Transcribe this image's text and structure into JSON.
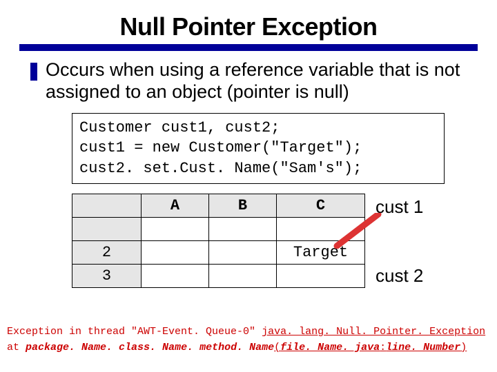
{
  "title": "Null Pointer Exception",
  "bullet": "Occurs when using a reference variable that is not assigned to an object (pointer is null)",
  "code": {
    "line1": "Customer cust1, cust2;",
    "line2": "cust1 = new Customer(\"Target\");",
    "line3": "cust2. set.Cust. Name(\"Sam's\");"
  },
  "table": {
    "headers": {
      "a": "A",
      "b": "B",
      "c": "C"
    },
    "rows": [
      {
        "hdr": "2",
        "a": "",
        "b": "",
        "c": "Target"
      },
      {
        "hdr": "3",
        "a": "",
        "b": "",
        "c": ""
      }
    ]
  },
  "labels": {
    "cust1": "cust 1",
    "cust2": "cust 2"
  },
  "exception": {
    "line1_a": "Exception in thread \"AWT-Event. Queue-0\" ",
    "line1_b": "java. lang. Null. Pointer. Exception",
    "line2_a": " at ",
    "line2_pkg": "package. Name.",
    "line2_cls": " class. Name.",
    "line2_mth": " method. Name",
    "line2_paren_open": "(",
    "line2_file": "file. Name. java",
    "line2_colon": ":",
    "line2_line": "line. Number",
    "line2_paren_close": ")"
  }
}
